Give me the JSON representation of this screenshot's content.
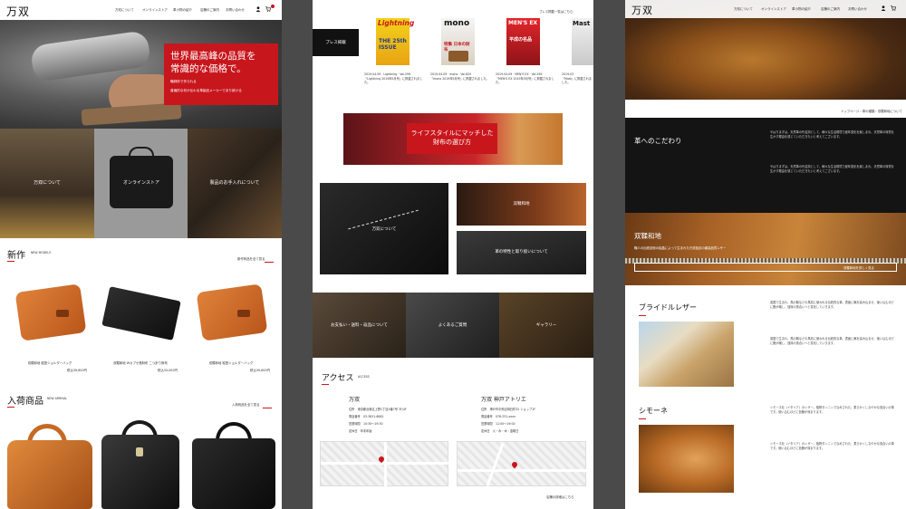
{
  "p1": {
    "logo": "万双",
    "nav": [
      "万双について",
      "オンラインストア",
      "革小物の紹介",
      "店舗のご案内",
      "お問い合わせ"
    ],
    "hero_title_l1": "世界最高峰の品質を",
    "hero_title_l2": "常識的な価格で。",
    "hero_sub_l1": "職師府で作られる",
    "hero_sub_l2": "普遍的な何か伝わる革製品メーカーであり続ける",
    "tiles": [
      "万双について",
      "オンラインストア",
      "製品のお手入れについて"
    ],
    "new_title": "新作",
    "new_sub": "NEW MODELS",
    "new_more": "新作商品を全て見る",
    "new_products": [
      {
        "name": "双鞣和地 縦型ショルダーバッグ",
        "price": "税込39,600円"
      },
      {
        "name": "双鞣和地 Wカブセ長財布 二つ折り財布",
        "price": "税込33,000円"
      },
      {
        "name": "双鞣和地 縦型ショルダーバッグ",
        "price": "税込39,600円"
      }
    ],
    "arrival_title": "入荷商品",
    "arrival_sub": "NEW ARRIVAL",
    "arrival_more": "入荷商品を全て見る",
    "colors": {
      "accent": "#c8161d"
    }
  },
  "p2": {
    "press_label": "プレス掲載",
    "press_more": "プレス掲載一覧はこちら",
    "magazines": [
      {
        "title": "Lightning",
        "cover": "THE 25th ISSUE",
        "caption_date": "2019.04.09 · Lightning · Vol.299",
        "caption": "『Lightning 2019年5月号』に掲載されました。"
      },
      {
        "title": "mono",
        "cover": "特集 日本の財布",
        "caption_date": "2019.04.09 · mono · Vol.820",
        "caption": "『mono 2019年5月号』に掲載されました。"
      },
      {
        "title": "MEN'S EX",
        "cover": "平成の名品",
        "caption_date": "2019.04.09 · MEN'S EX · Vol.299",
        "caption": "『MEN'S EX 2019年5月号』に掲載されました。"
      },
      {
        "title": "Mast",
        "cover": "",
        "caption_date": "2019.03",
        "caption": "『Mast』に掲載されました。"
      }
    ],
    "banner_l1": "ライフスタイルにマッチした",
    "banner_l2": "財布の選び方",
    "tiles": [
      "万双について",
      "双鞣和地",
      "革の特性と取り扱いについて"
    ],
    "bottom_tiles": [
      "お支払い・送料・返品について",
      "よくあるご質問",
      "ギャラリー"
    ],
    "access_title": "アクセス",
    "access_sub": "ACCESS",
    "shops": [
      {
        "name": "万双",
        "fields": [
          {
            "k": "住所",
            "v": "東京都台東区上野1丁目4番7号 3F/4F"
          },
          {
            "k": "電話番号",
            "v": "03-3831-6681"
          },
          {
            "k": "営業時間",
            "v": "10:30〜19:30"
          },
          {
            "k": "定休日",
            "v": "年末年始"
          }
        ]
      },
      {
        "name": "万双 神戸アトリエ",
        "fields": [
          {
            "k": "住所",
            "v": "神戸市中央区明石町32 ショップ1F"
          },
          {
            "k": "電話番号",
            "v": "078-331-xxxx"
          },
          {
            "k": "営業時間",
            "v": "11:00〜19:00"
          },
          {
            "k": "定休日",
            "v": "火・水・木・金曜日"
          }
        ]
      }
    ],
    "shop_more": "店舗の詳細はこちら"
  },
  "p3": {
    "logo": "万双",
    "nav": [
      "万双について",
      "オンラインストア",
      "革小物の紹介",
      "店舗のご案内",
      "お問い合わせ"
    ],
    "breadcrumb": "トップページ › 革の種類 › 双鞣和地について",
    "kodawari_title": "革へのこだわり",
    "kodawari_text": "やはりまずは、天然革の代名詞として、様々な生活環境で経年変化を楽しまれ、天然革の特質を生かす理由を感じていただきたいと考えてございます。",
    "soujyu_title": "双鞣和地",
    "soujyu_sub": "職人の伝統技術の結晶によって生まれた万双独自の最高品質レザー",
    "soujyu_more": "双鞣和地を詳しく見る",
    "bridle_title": "ブライドルレザー",
    "bridle_text": "英国で生まれ、馬の鞍などの馬具に使われる伝統的な革。表面に蝋を染み込ませ、使い込むほどに艶が増し、独特の風合いへと変化していきます。",
    "simone_title": "シモーネ",
    "simone_text": "シモーネ社（イタリア）のレザー。植物タンニンでなめされた、柔らかくしなやかな風合いの革です。使い込むほどに色艶が深まります。"
  }
}
